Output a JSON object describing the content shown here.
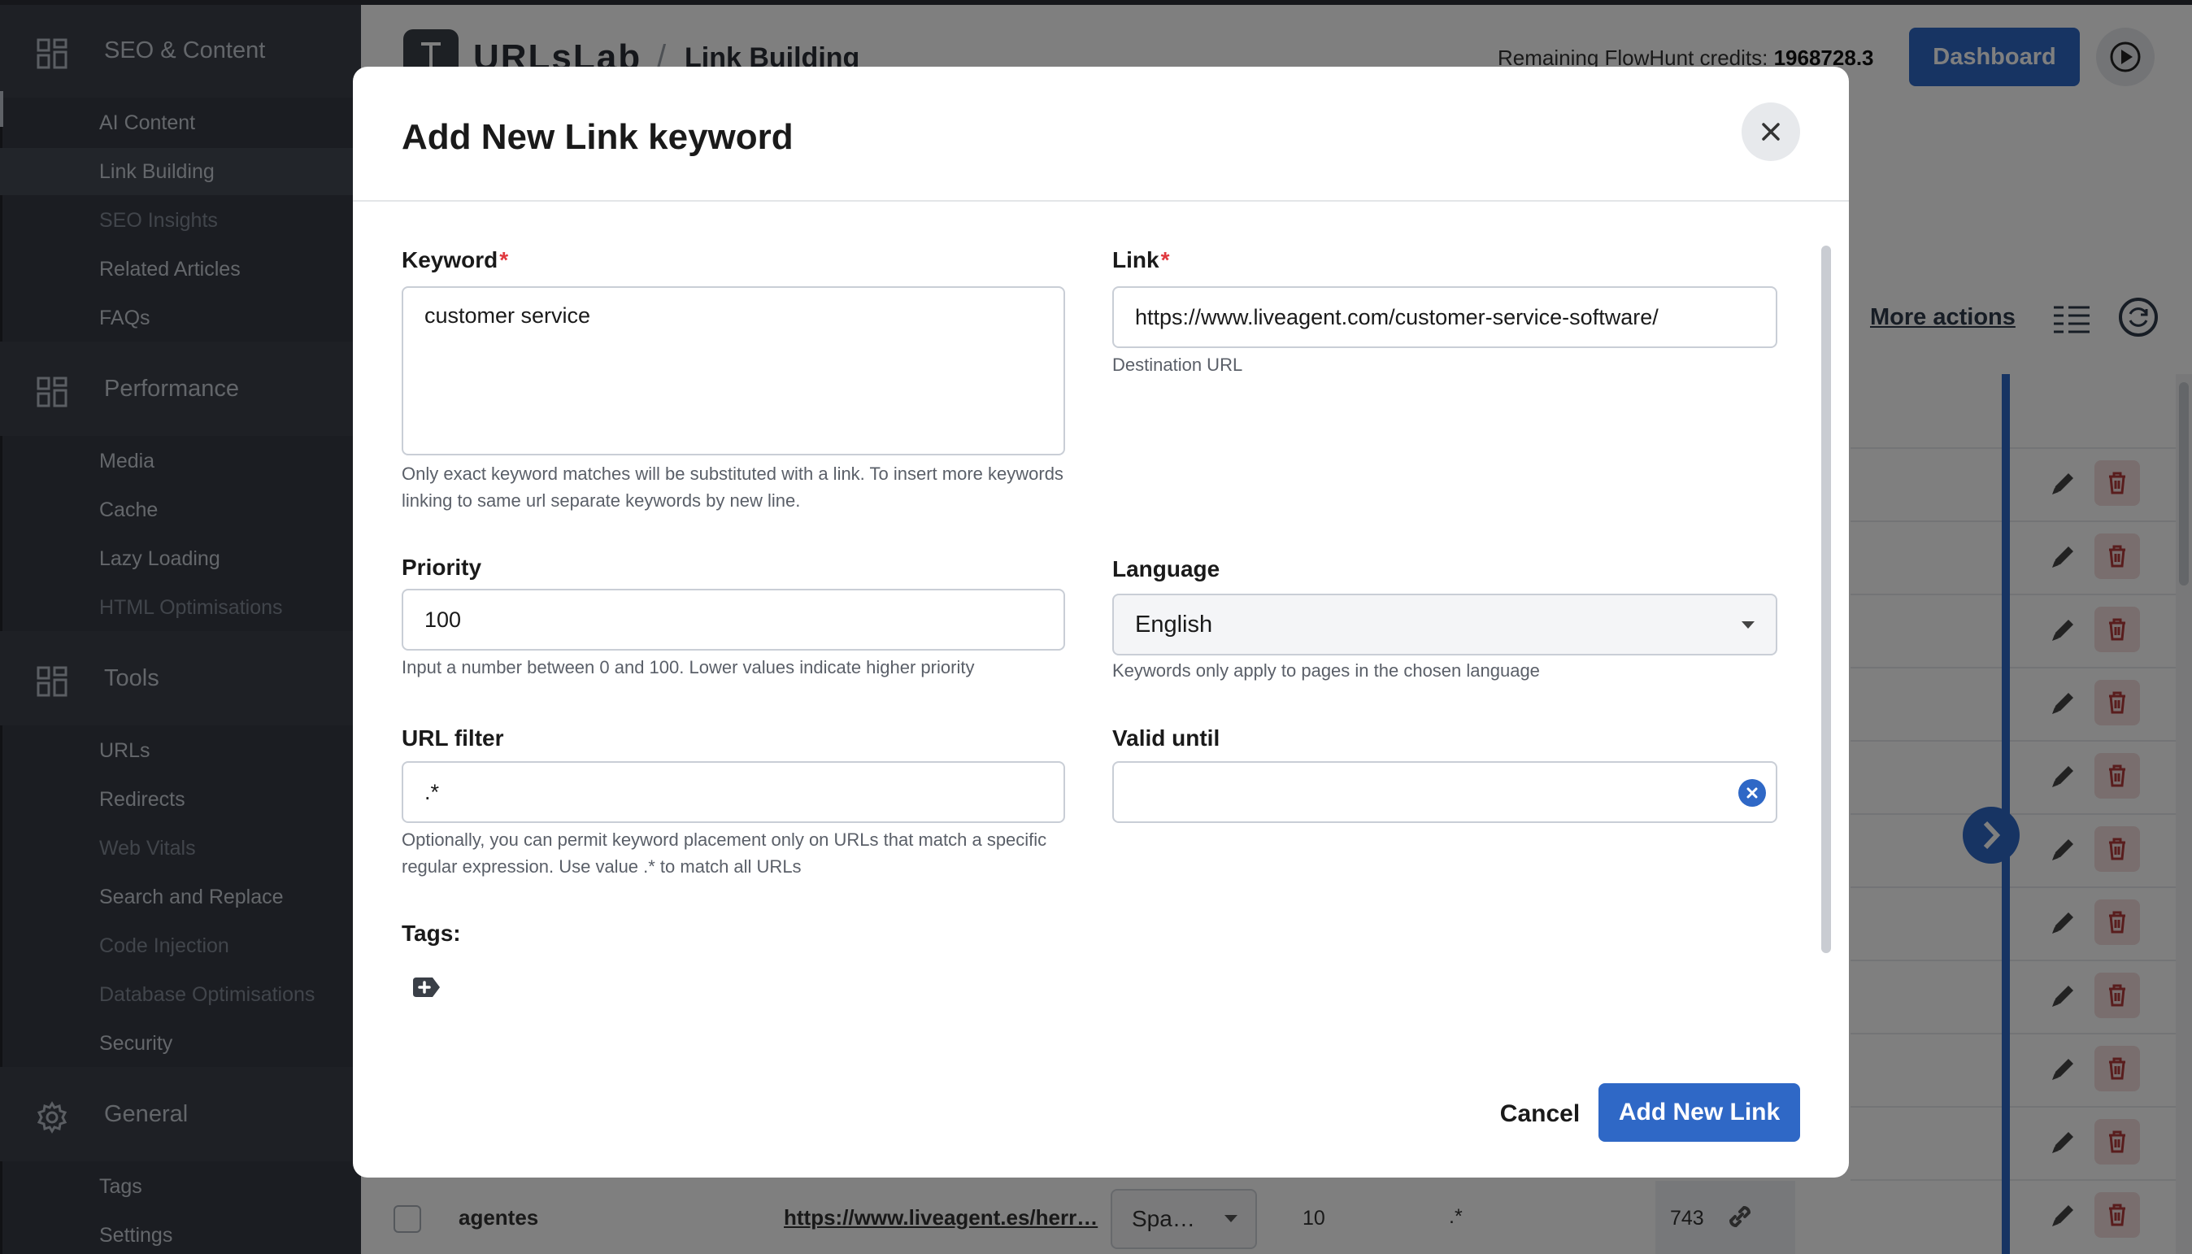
{
  "sidebar": {
    "groups": [
      {
        "label": "SEO & Content",
        "icon": "grid-icon"
      },
      {
        "label": "Performance",
        "icon": "grid-icon"
      },
      {
        "label": "Tools",
        "icon": "grid-icon"
      },
      {
        "label": "General",
        "icon": "gear-icon"
      }
    ],
    "seo_items": [
      "AI Content",
      "Link Building",
      "SEO Insights",
      "Related Articles",
      "FAQs"
    ],
    "performance_items": [
      "Media",
      "Cache",
      "Lazy Loading",
      "HTML Optimisations"
    ],
    "tools_items": [
      "URLs",
      "Redirects",
      "Web Vitals",
      "Search and Replace",
      "Code Injection",
      "Database Optimisations",
      "Security"
    ],
    "general_items": [
      "Tags",
      "Settings"
    ],
    "active_item": "Link Building"
  },
  "header": {
    "logo": "URLsLab",
    "separator": "/",
    "title": "Link Building",
    "credits_label": "Remaining FlowHunt credits:",
    "credits_value": "1968728.3",
    "dashboard_button": "Dashboard"
  },
  "toolbar": {
    "more_actions": "More actions"
  },
  "background_row": {
    "keyword": "agentes",
    "url": "https://www.liveagent.es/herr…",
    "language": "Spa…",
    "priority": "10",
    "url_filter": ".*",
    "count": "743"
  },
  "modal": {
    "title": "Add New Link keyword",
    "keyword": {
      "label": "Keyword",
      "required": "*",
      "value": "customer service",
      "help": "Only exact keyword matches will be substituted with a link. To insert more keywords linking to same url separate keywords by new line."
    },
    "link": {
      "label": "Link",
      "required": "*",
      "value": "https://www.liveagent.com/customer-service-software/",
      "help": "Destination URL"
    },
    "priority": {
      "label": "Priority",
      "value": "100",
      "help": "Input a number between 0 and 100. Lower values indicate higher priority"
    },
    "language": {
      "label": "Language",
      "value": "English",
      "help": "Keywords only apply to pages in the chosen language"
    },
    "url_filter": {
      "label": "URL filter",
      "value": ".*",
      "help": "Optionally, you can permit keyword placement only on URLs that match a specific regular expression. Use value .* to match all URLs"
    },
    "valid_until": {
      "label": "Valid until",
      "value": ""
    },
    "tags": {
      "label": "Tags:"
    },
    "cancel_button": "Cancel",
    "submit_button": "Add New Link"
  },
  "colors": {
    "primary": "#2f68c6",
    "sidebar_bg": "#373b44",
    "required": "#e0383e",
    "delete_bg": "#f3dddd"
  }
}
